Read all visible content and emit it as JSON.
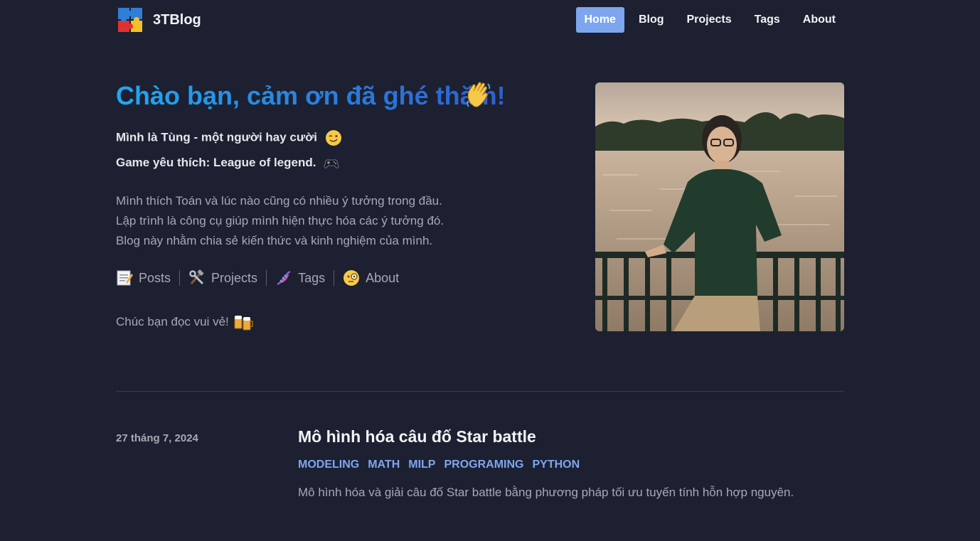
{
  "header": {
    "site_title": "3TBlog",
    "logo_icon": "puzzle-icon",
    "nav": [
      {
        "label": "Home",
        "active": true
      },
      {
        "label": "Blog",
        "active": false
      },
      {
        "label": "Projects",
        "active": false
      },
      {
        "label": "Tags",
        "active": false
      },
      {
        "label": "About",
        "active": false
      }
    ]
  },
  "hero": {
    "title": "Chào bạn, cảm ơn đã ghé thăm!",
    "title_emoji": "waving-hand-icon",
    "intro_line_1": "Mình là Tùng - một người hay cười",
    "intro_line_1_emoji": "winking-face-icon",
    "intro_line_2": "Game yêu thích: League of legend.",
    "intro_line_2_emoji": "game-controller-icon",
    "description": [
      "Mình thích Toán và lúc nào cũng có nhiều ý tưởng trong đầu.",
      "Lập trình là công cụ giúp mình hiện thực hóa các ý tưởng đó.",
      "Blog này nhằm chia sẻ kiến thức và kinh nghiệm của mình."
    ],
    "quick_links": [
      {
        "label": "Posts",
        "icon": "memo-icon"
      },
      {
        "label": "Projects",
        "icon": "hammer-wrench-icon"
      },
      {
        "label": "Tags",
        "icon": "dna-icon"
      },
      {
        "label": "About",
        "icon": "monocle-face-icon"
      }
    ],
    "closing": "Chúc bạn đọc vui vẻ!",
    "closing_emoji": "beer-mugs-icon",
    "photo": "profile-photo"
  },
  "posts": [
    {
      "date": "27 tháng 7, 2024",
      "title": "Mô hình hóa câu đố Star battle",
      "tags": [
        "MODELING",
        "MATH",
        "MILP",
        "PROGRAMING",
        "PYTHON"
      ],
      "summary": "Mô hình hóa và giải câu đố Star battle bằng phương pháp tối ưu tuyến tính hỗn hợp nguyên."
    }
  ],
  "colors": {
    "background": "#1c2031",
    "accent": "#7ea6ef",
    "title_gradient_start": "#22a7f0",
    "title_gradient_end": "#2e5fcf",
    "muted_text": "#a6aab4"
  }
}
